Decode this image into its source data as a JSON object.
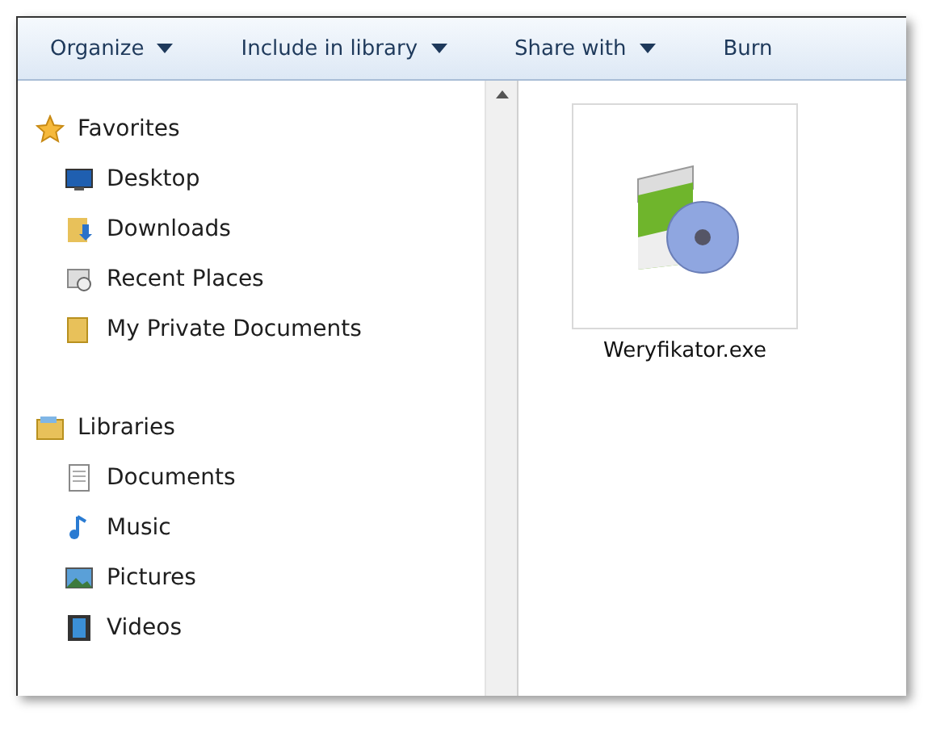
{
  "toolbar": [
    {
      "label": "Organize",
      "dropdown": true
    },
    {
      "label": "Include in library",
      "dropdown": true
    },
    {
      "label": "Share with",
      "dropdown": true
    },
    {
      "label": "Burn",
      "dropdown": false
    }
  ],
  "navigation": [
    {
      "label": "Favorites",
      "kind": "star",
      "children": [
        {
          "label": "Desktop",
          "kind": "desktop"
        },
        {
          "label": "Downloads",
          "kind": "download"
        },
        {
          "label": "Recent Places",
          "kind": "recent"
        },
        {
          "label": "My Private Documents",
          "kind": "folder"
        }
      ]
    },
    {
      "label": "Libraries",
      "kind": "library",
      "children": [
        {
          "label": "Documents",
          "kind": "document"
        },
        {
          "label": "Music",
          "kind": "music"
        },
        {
          "label": "Pictures",
          "kind": "picture"
        },
        {
          "label": "Videos",
          "kind": "video"
        }
      ]
    }
  ],
  "files": [
    {
      "name": "Weryfikator.exe",
      "selected": true
    }
  ]
}
